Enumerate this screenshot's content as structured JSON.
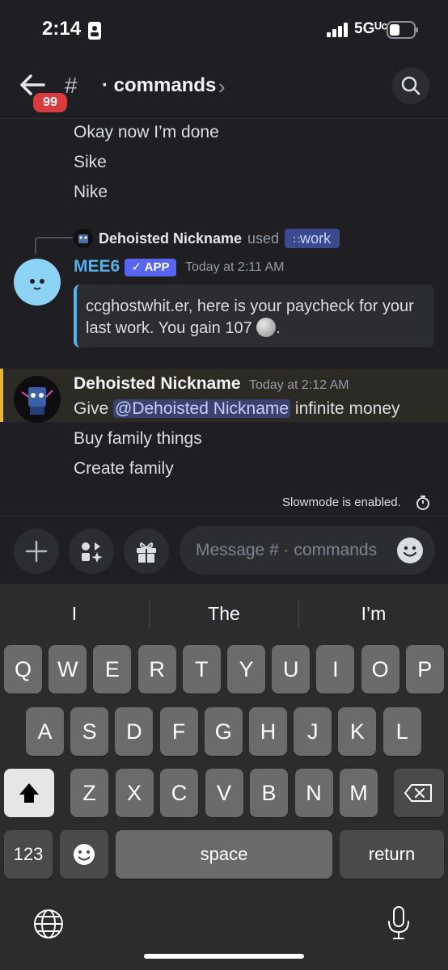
{
  "status": {
    "time": "2:14",
    "network": "5Gᵁᶜ"
  },
  "header": {
    "badge": "99",
    "channel_hash": "#",
    "title": "· commands",
    "chevron": "›"
  },
  "messages": {
    "earlier": [
      "Okay now I’m done",
      "Sike",
      "Nike"
    ],
    "reply": {
      "user": "Dehoisted Nickname",
      "used": "used",
      "command": "work"
    },
    "bot": {
      "name": "MEE6",
      "tag": "✓ APP",
      "time": "Today at 2:11 AM",
      "embed_text": "ccghostwhit.er, here is your paycheck for your last work. You gain 107"
    },
    "user_msg": {
      "name": "Dehoisted Nickname",
      "time": "Today at 2:12 AM",
      "line1_pre": "Give ",
      "mention": "@Dehoisted Nickname",
      "line1_post": " infinite money",
      "lines": [
        "Buy family things",
        "Create family"
      ]
    },
    "slowmode": "Slowmode is enabled."
  },
  "composer": {
    "placeholder": "Message # · commands"
  },
  "keyboard": {
    "suggestions": [
      "I",
      "The",
      "I’m"
    ],
    "row1": [
      "Q",
      "W",
      "E",
      "R",
      "T",
      "Y",
      "U",
      "I",
      "O",
      "P"
    ],
    "row2": [
      "A",
      "S",
      "D",
      "F",
      "G",
      "H",
      "J",
      "K",
      "L"
    ],
    "row3": [
      "Z",
      "X",
      "C",
      "V",
      "B",
      "N",
      "M"
    ],
    "numbers": "123",
    "space": "space",
    "return": "return"
  },
  "colors": {
    "bot_name": "#5ab0e6",
    "app_tag": "#5865f2",
    "badge": "#d83c3e",
    "highlight": "#f0b232"
  }
}
